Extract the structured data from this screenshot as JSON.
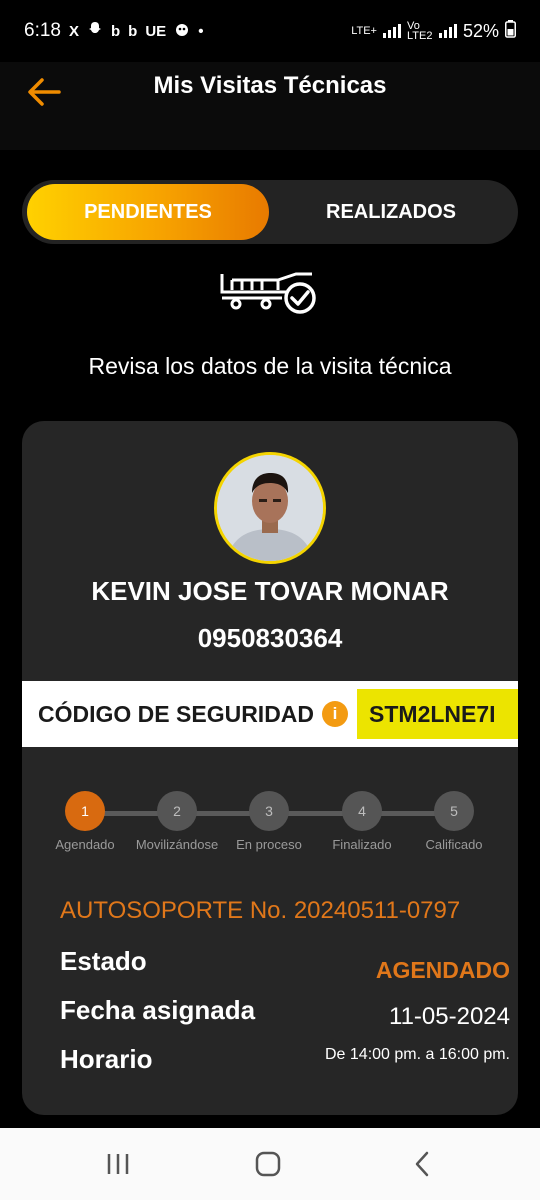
{
  "status_bar": {
    "time": "6:18",
    "notifications": [
      "X",
      "b",
      "b",
      "UE",
      "•"
    ],
    "network_1": "LTE+",
    "network_2": "Vo LTE2",
    "battery": "52%"
  },
  "header": {
    "title": "Mis Visitas Técnicas",
    "back_icon": "arrow-left-icon",
    "accent_color": "#f08c00"
  },
  "tabs": [
    {
      "label": "PENDIENTES",
      "active": true
    },
    {
      "label": "REALIZADOS",
      "active": false
    }
  ],
  "intro": {
    "icon": "truck-check-icon",
    "text": "Revisa los datos de la visita técnica"
  },
  "technician": {
    "name": "KEVIN JOSE TOVAR MONAR",
    "id_number": "0950830364",
    "avatar_border_color": "#f4d400"
  },
  "security": {
    "label": "CÓDIGO DE SEGURIDAD",
    "info_icon": "info-icon",
    "code": "STM2LNE7I"
  },
  "progress": {
    "current_step": 1,
    "steps": [
      {
        "number": "1",
        "label": "Agendado"
      },
      {
        "number": "2",
        "label": "Movilizándose"
      },
      {
        "number": "3",
        "label": "En proceso"
      },
      {
        "number": "4",
        "label": "Finalizado"
      },
      {
        "number": "5",
        "label": "Calificado"
      }
    ]
  },
  "visit": {
    "ticket": "AUTOSOPORTE No. 20240511-0797",
    "status_label": "Estado",
    "status_value": "AGENDADO",
    "date_label": "Fecha asignada",
    "date_value": "11-05-2024",
    "time_label": "Horario",
    "time_value": "De 14:00 pm. a 16:00 pm."
  },
  "nav_bar": {
    "recents_icon": "recents-icon",
    "home_icon": "home-icon",
    "back_icon": "back-icon"
  }
}
